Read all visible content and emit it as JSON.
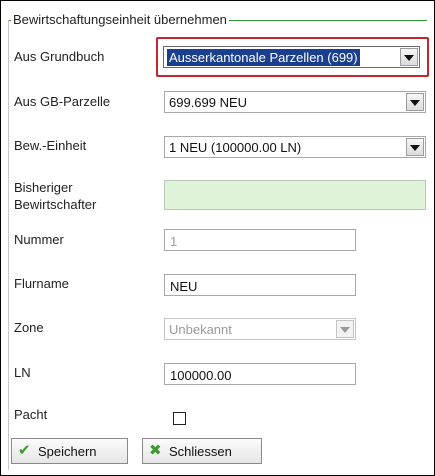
{
  "fieldset": {
    "legend": "Bewirtschaftungseinheit übernehmen"
  },
  "rows": {
    "grundbuch": {
      "label": "Aus Grundbuch",
      "value": "Ausserkantonale Parzellen (699)"
    },
    "gb_parzelle": {
      "label": "Aus GB-Parzelle",
      "value": "699.699 NEU"
    },
    "bew_einheit": {
      "label": "Bew.-Einheit",
      "value": "1 NEU (100000.00 LN)"
    },
    "bisheriger": {
      "label_line1": "Bisheriger",
      "label_line2": "Bewirtschafter",
      "value": ""
    },
    "nummer": {
      "label": "Nummer",
      "value": "1"
    },
    "flurname": {
      "label": "Flurname",
      "value": "NEU"
    },
    "zone": {
      "label": "Zone",
      "value": "Unbekannt"
    },
    "ln": {
      "label": "LN",
      "value": "100000.00"
    },
    "pacht": {
      "label": "Pacht",
      "checked": false
    }
  },
  "buttons": {
    "save": {
      "label": "Speichern",
      "icon": "check-icon"
    },
    "close": {
      "label": "Schliessen",
      "icon": "close-icon"
    }
  },
  "colors": {
    "accent_green": "#2e9e3a",
    "highlight_red": "#c1272d",
    "selected_blue": "#1b3f8f",
    "readonly_green": "#dff2da"
  }
}
